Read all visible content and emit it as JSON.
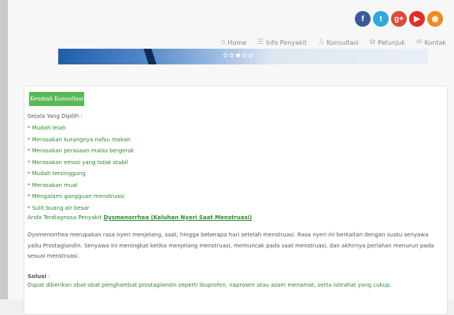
{
  "social": [
    {
      "name": "facebook-icon",
      "glyph": "f",
      "color": "#3b5998"
    },
    {
      "name": "twitter-icon",
      "glyph": "t",
      "color": "#2ea9e0"
    },
    {
      "name": "google-plus-icon",
      "glyph": "g+",
      "color": "#db4a39"
    },
    {
      "name": "youtube-icon",
      "glyph": "▶",
      "color": "#e52d27"
    },
    {
      "name": "rss-icon",
      "glyph": "◉",
      "color": "#f0891e"
    }
  ],
  "nav": [
    {
      "icon": "⌂",
      "label": "Home"
    },
    {
      "icon": "☰",
      "label": "Info Penyakit"
    },
    {
      "icon": "♙",
      "label": "Konsultasi"
    },
    {
      "icon": "✿",
      "label": "Petunjuk"
    },
    {
      "icon": "✉",
      "label": "Kontak"
    }
  ],
  "back_button": "Kembali Konsultasi",
  "symptoms_header": "Gejala Yang Dipilih :",
  "symptoms": [
    "Mudah lelah",
    "Merasakan kurangnya nafsu makan",
    "Merasakan perasaan malas bergerak",
    "Merasakan emosi yang tidak stabil",
    "Mudah tersinggung",
    "Merasakan mual",
    "Mengalami gangguan menstruasi",
    "Sulit buang air besar"
  ],
  "diagnosis_prefix": "Anda Terdiagnosa Penyakit",
  "diagnosis_name": "Dysmenorrhea (Keluhan Nyeri Saat Menstruasi)",
  "description": "Dysmenorrhea merupakan rasa nyeri menjelang, saat, hingga beberapa hari setelah menstruasi. Rasa nyeri ini berkaitan dengan suatu senyawa yaitu Prostaglandin. Senyawa ini meningkat ketika menjelang menstruasi, memuncak pada saat menstruasi, dan akhirnya perlahan menurun pada sesuai menstruasi.",
  "solution_label": "Solusi",
  "solution_sep": ":",
  "solution_text": "Dapat diberikan obat-obat penghambat prostaglandin seperti ibuprofen, naproxen atau asam menamat, serta istirahat yang cukup."
}
